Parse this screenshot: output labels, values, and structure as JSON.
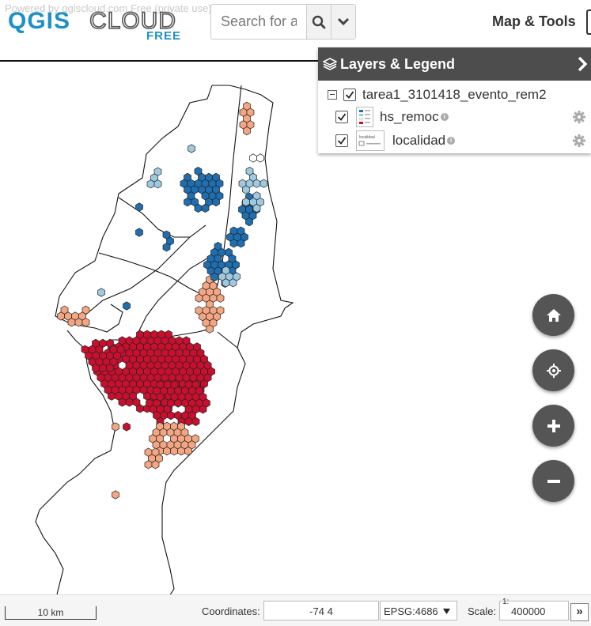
{
  "header": {
    "powered_text": "Powered by qgiscloud.com Free (private use) by Sourcepole AG Zürich",
    "logo_main": "QGIS CLOUD",
    "logo_sub": "FREE",
    "search_placeholder": "Search for address",
    "map_tools_label": "Map & Tools"
  },
  "layers_panel": {
    "title": "Layers & Legend",
    "group": {
      "label": "tarea1_3101418_evento_rem2",
      "checked": true
    },
    "layers": [
      {
        "label": "hs_remoc",
        "checked": true
      },
      {
        "label": "localidad",
        "checked": true
      }
    ],
    "legend_thumb_text": "localidad"
  },
  "footer": {
    "scale_bar_label": "10 km",
    "coordinates_label": "Coordinates:",
    "coordinates_value": "-74 4",
    "crs_value": "EPSG:4686",
    "scale_label": "Scale:",
    "scale_prefix": "1:",
    "scale_value": "400000",
    "expand_label": "»"
  },
  "colors": {
    "dark_blue": "#1f6fb0",
    "light_blue": "#9ecae1",
    "white_hex": "#ffffff",
    "salmon": "#f4a582",
    "red": "#c8102e",
    "panel_header": "#4d4d4d",
    "button_bg": "#555555",
    "logo_blue": "#1e90c8"
  },
  "icons": {
    "search": "magnifier-icon",
    "dropdown": "chevron-down-icon",
    "layers": "layers-stack-icon",
    "panel_toggle": "chevron-right-icon",
    "home": "home-icon",
    "locate": "crosshair-icon",
    "zoom_in": "plus-icon",
    "zoom_out": "minus-icon",
    "settings": "gear-icon",
    "info": "info-icon"
  }
}
